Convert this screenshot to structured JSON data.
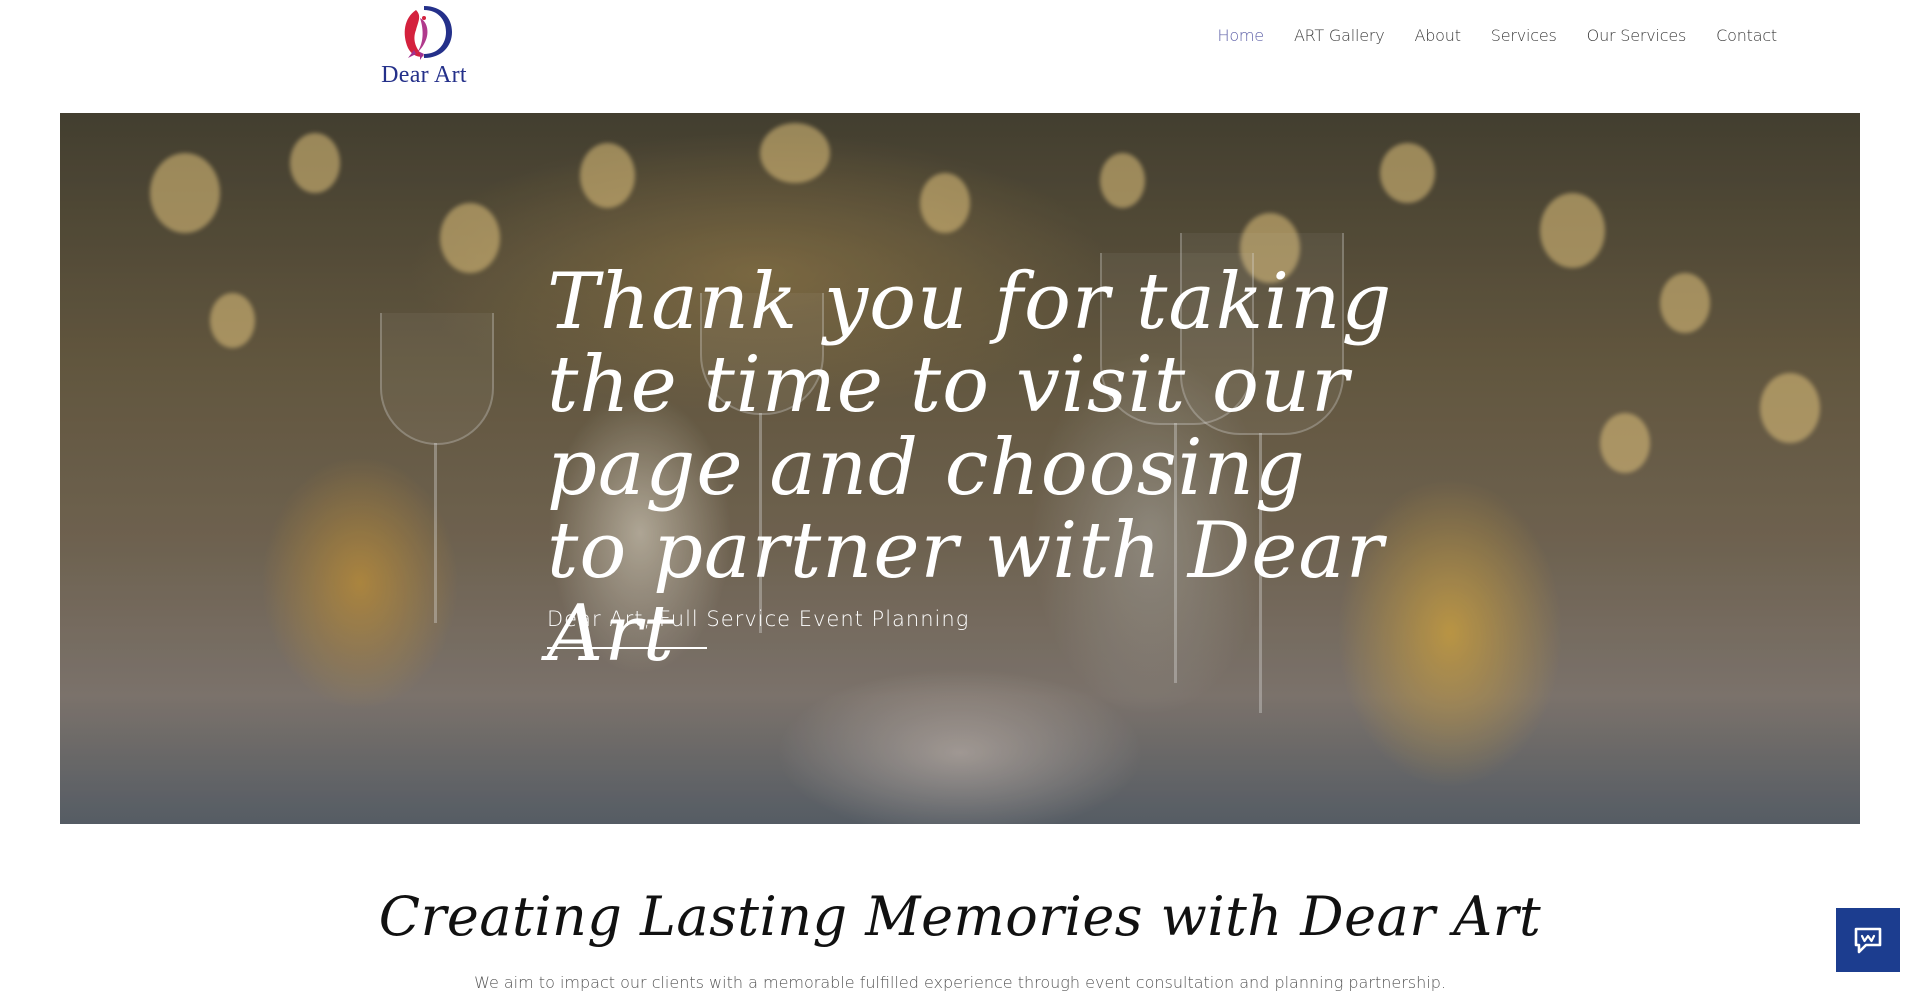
{
  "brand": {
    "name": "Dear Art"
  },
  "nav": {
    "items": [
      "Home",
      "ART Gallery",
      "About",
      "Services",
      "Our Services",
      "Contact"
    ],
    "active": "Home"
  },
  "hero": {
    "title": "Thank you for taking the time to visit our page and choosing to partner with Dear Art",
    "subtitle": "Dear Art, Full Service Event Planning"
  },
  "section": {
    "title": "Creating Lasting Memories with Dear Art",
    "text": "We aim to impact our clients with a memorable fulfilled experience through event consultation and planning partnership."
  },
  "colors": {
    "nav_active": "#5b5ea6",
    "brand_text": "#24308a",
    "chat_button": "#1c3d8f"
  },
  "icons": {
    "logo": "dear-art-logo-icon",
    "chat": "chat-icon"
  }
}
